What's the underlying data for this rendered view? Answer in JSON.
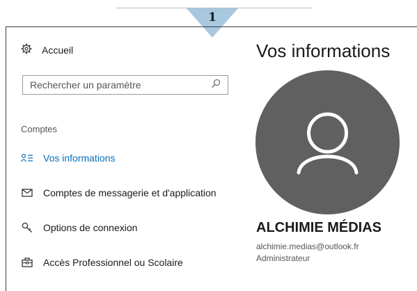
{
  "step_badge": {
    "number": "1"
  },
  "nav": {
    "home_label": "Accueil",
    "search_placeholder": "Rechercher un paramètre",
    "section_title": "Comptes",
    "items": [
      {
        "label": "Vos informations",
        "icon": "person-list-icon",
        "active": true
      },
      {
        "label": "Comptes de messagerie et d'application",
        "icon": "mail-icon",
        "active": false
      },
      {
        "label": "Options de connexion",
        "icon": "key-icon",
        "active": false
      },
      {
        "label": "Accès Professionnel ou Scolaire",
        "icon": "briefcase-icon",
        "active": false
      }
    ]
  },
  "main": {
    "title": "Vos informations",
    "avatar_icon": "user-icon",
    "user_name": "ALCHIMIE MÉDIAS",
    "user_email": "alchimie.medias@outlook.fr",
    "user_role": "Administrateur"
  },
  "colors": {
    "accent": "#0a6fb8",
    "avatar_bg": "#606060",
    "badge": "#a8c8e0"
  }
}
